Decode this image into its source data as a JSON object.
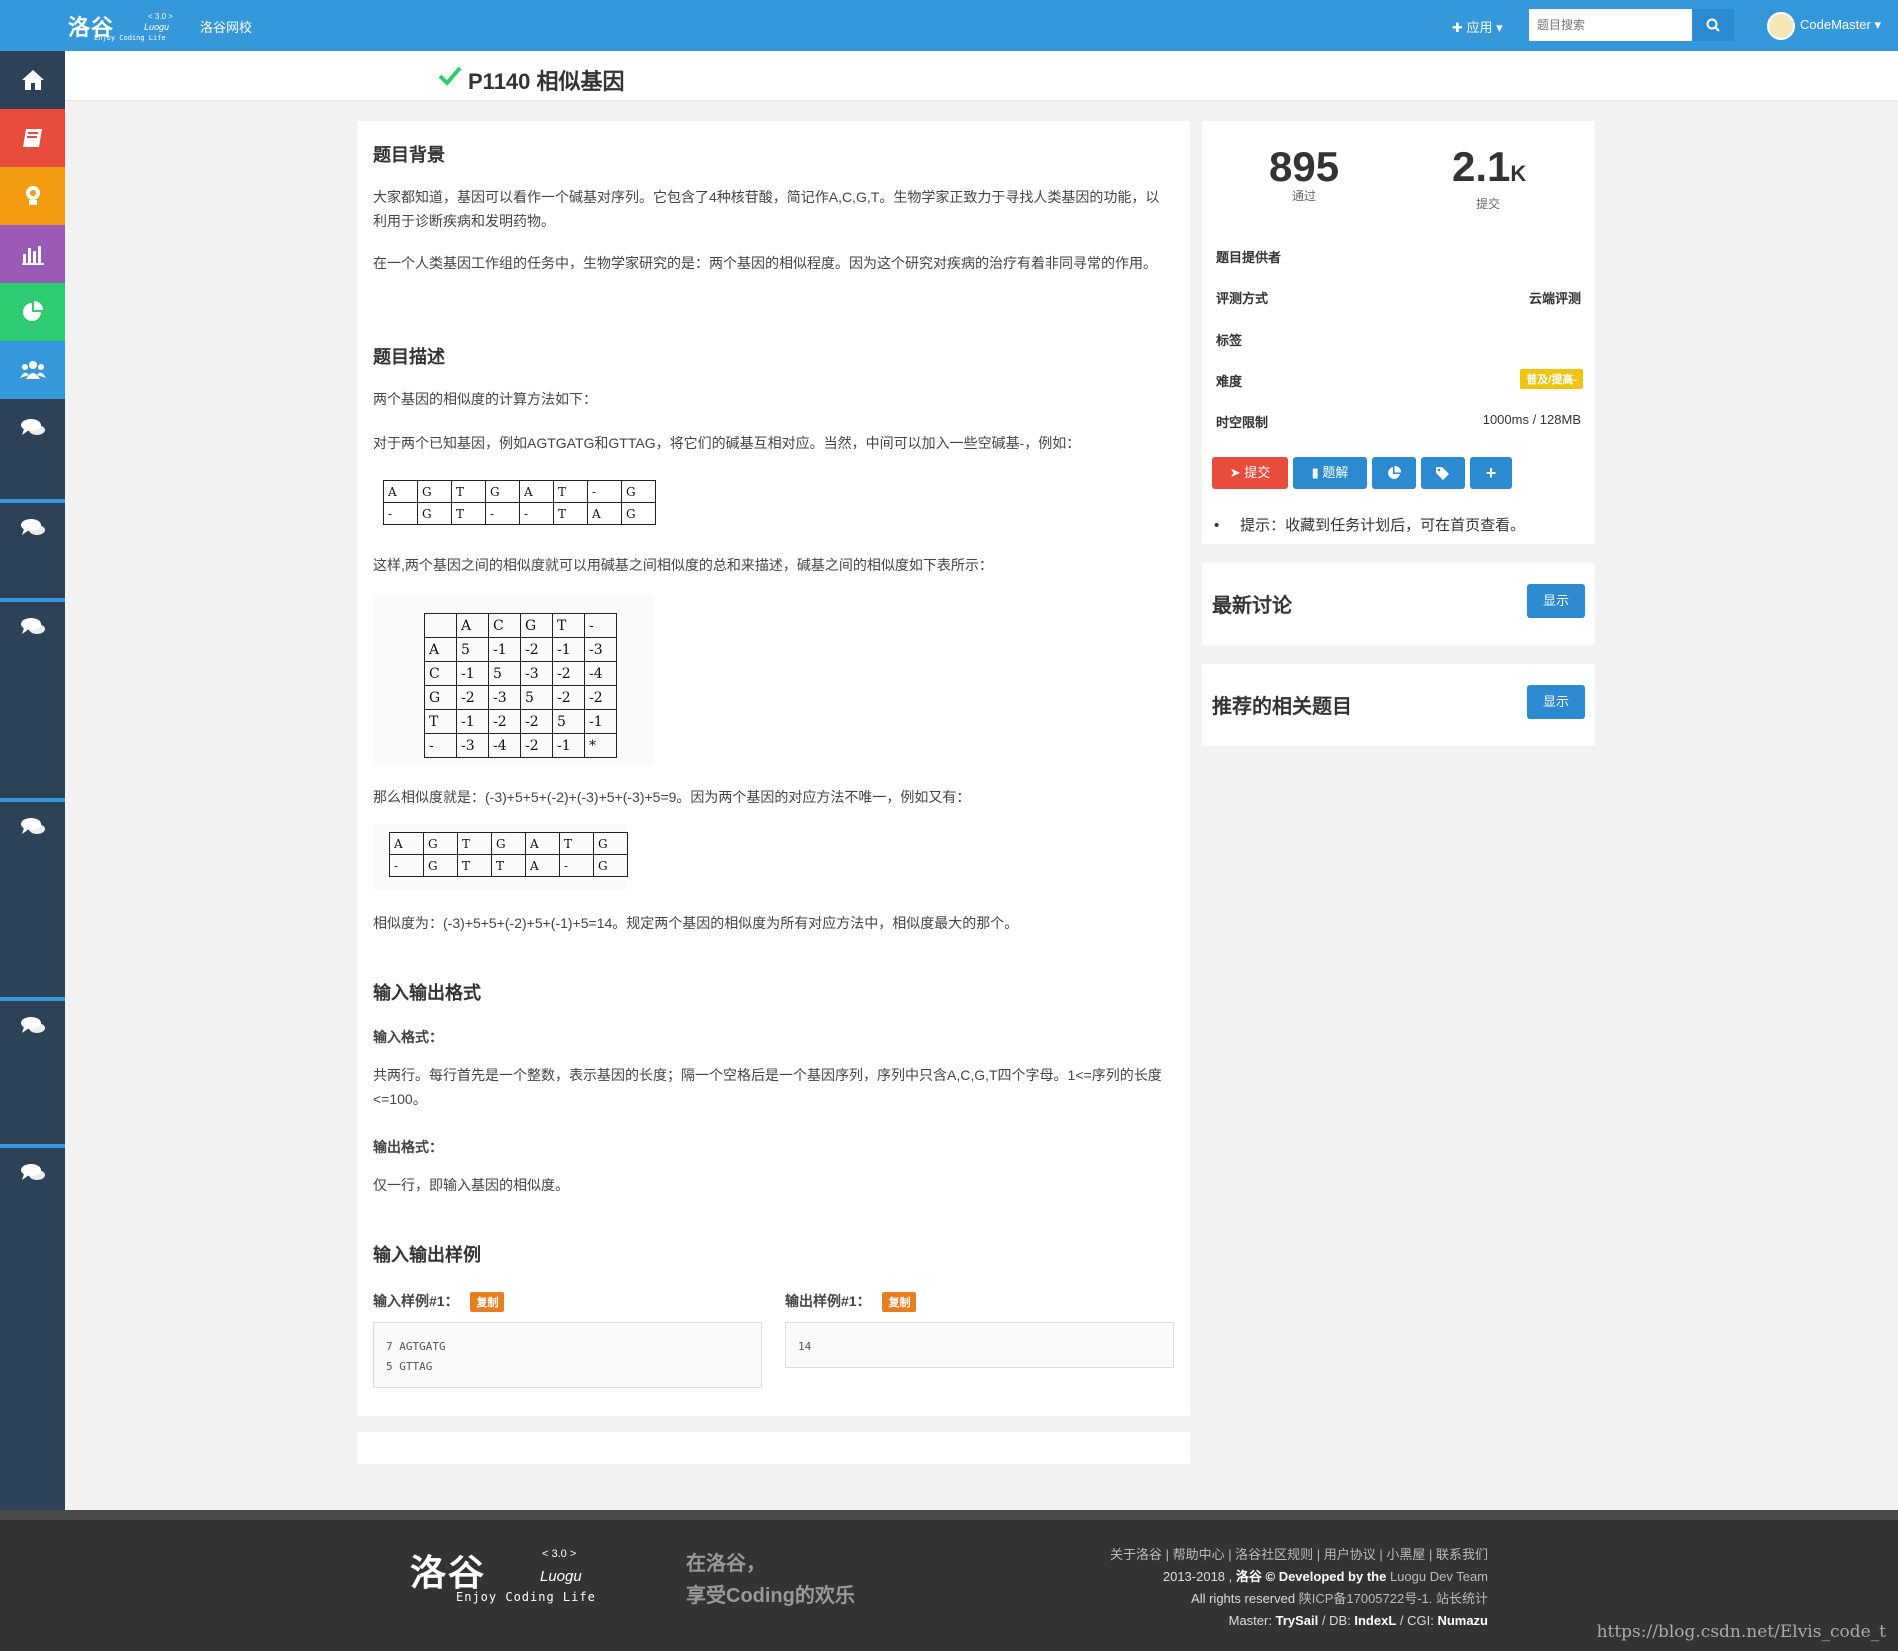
{
  "topnav": {
    "logo_text": "洛谷",
    "logo_version": "< 3.0 >",
    "logo_latin": "Luogu",
    "logo_tagline": "Enjoy Coding Life",
    "school_link": "洛谷网校",
    "apps_menu": "应用",
    "search_placeholder": "题目搜索",
    "user_name": "CodeMaster"
  },
  "problem": {
    "title": "P1140 相似基因",
    "sections": {
      "background_h": "题目背景",
      "background_p1": "大家都知道，基因可以看作一个碱基对序列。它包含了4种核苷酸，简记作A,C,G,T。生物学家正致力于寻找人类基因的功能，以利用于诊断疾病和发明药物。",
      "background_p2": "在一个人类基因工作组的任务中，生物学家研究的是：两个基因的相似程度。因为这个研究对疾病的治疗有着非同寻常的作用。",
      "desc_h": "题目描述",
      "desc_p1": "两个基因的相似度的计算方法如下：",
      "desc_p2": "对于两个已知基因，例如AGTGATG和GTTAG，将它们的碱基互相对应。当然，中间可以加入一些空碱基-，例如：",
      "desc_p3": "这样,两个基因之间的相似度就可以用碱基之间相似度的总和来描述，碱基之间的相似度如下表所示：",
      "desc_p4": "那么相似度就是：(-3)+5+5+(-2)+(-3)+5+(-3)+5=9。因为两个基因的对应方法不唯一，例如又有：",
      "desc_p5": "相似度为：(-3)+5+5+(-2)+5+(-1)+5=14。规定两个基因的相似度为所有对应方法中，相似度最大的那个。",
      "io_h": "输入输出格式",
      "input_label": "输入格式：",
      "input_text": "共两行。每行首先是一个整数，表示基因的长度；隔一个空格后是一个基因序列，序列中只含A,C,G,T四个字母。1<=序列的长度<=100。",
      "output_label": "输出格式：",
      "output_text": "仅一行，即输入基因的相似度。",
      "samples_h": "输入输出样例",
      "sample_in_label": "输入样例#1：",
      "sample_out_label": "输出样例#1：",
      "copy_label": "复制",
      "sample_in_line1": "7 AGTGATG",
      "sample_in_line2": "5 GTTAG",
      "sample_out": "14"
    },
    "align1": [
      [
        "A",
        "G",
        "T",
        "G",
        "A",
        "T",
        "-",
        "G"
      ],
      [
        "-",
        "G",
        "T",
        "-",
        "-",
        "T",
        "A",
        "G"
      ]
    ],
    "score_table": [
      [
        "",
        "A",
        "C",
        "G",
        "T",
        "-"
      ],
      [
        "A",
        "5",
        "-1",
        "-2",
        "-1",
        "-3"
      ],
      [
        "C",
        "-1",
        "5",
        "-3",
        "-2",
        "-4"
      ],
      [
        "G",
        "-2",
        "-3",
        "5",
        "-2",
        "-2"
      ],
      [
        "T",
        "-1",
        "-2",
        "-2",
        "5",
        "-1"
      ],
      [
        "-",
        "-3",
        "-4",
        "-2",
        "-1",
        "*"
      ]
    ],
    "align2": [
      [
        "A",
        "G",
        "T",
        "G",
        "A",
        "T",
        "G"
      ],
      [
        "-",
        "G",
        "T",
        "T",
        "A",
        "-",
        "G"
      ]
    ]
  },
  "stats": {
    "accepted": "895",
    "accepted_label": "通过",
    "submitted": "2.1",
    "submitted_unit": "K",
    "submitted_label": "提交",
    "provider_label": "题目提供者",
    "judge_label": "评测方式",
    "judge_value": "云端评测",
    "tags_label": "标签",
    "difficulty_label": "难度",
    "difficulty_value": "普及/提高-",
    "limit_label": "时空限制",
    "limit_value": "1000ms / 128MB",
    "submit_btn": "提交",
    "solution_btn": "题解",
    "hint": "提示：收藏到任务计划后，可在首页查看。"
  },
  "discuss": {
    "title": "最新讨论",
    "show": "显示"
  },
  "related": {
    "title": "推荐的相关题目",
    "show": "显示"
  },
  "footer": {
    "slogan1": "在洛谷，",
    "slogan2": "享受Coding的欢乐",
    "links": "关于洛谷 | 帮助中心 | 洛谷社区规则 | 用户协议 | 小黑屋 | 联系我们",
    "line2_a": "2013-2018 , ",
    "line2_b": "洛谷",
    "line2_c": " © Developed by the ",
    "line2_d": "Luogu Dev Team",
    "line3_a": "All rights reserved ",
    "line3_b": "陕ICP备17005722号-1. 站长统计",
    "line4_a": "Master: ",
    "line4_b": "TrySail",
    "line4_c": " / DB: ",
    "line4_d": "IndexL",
    "line4_e": " / CGI: ",
    "line4_f": "Numazu",
    "watermark": "https://blog.csdn.net/Elvis_code_t"
  },
  "colors": {
    "primary": "#3498db",
    "sidebar": "#2e4257",
    "danger": "#e74c3c",
    "badge": "#f1c40f",
    "copy": "#e67e22"
  }
}
